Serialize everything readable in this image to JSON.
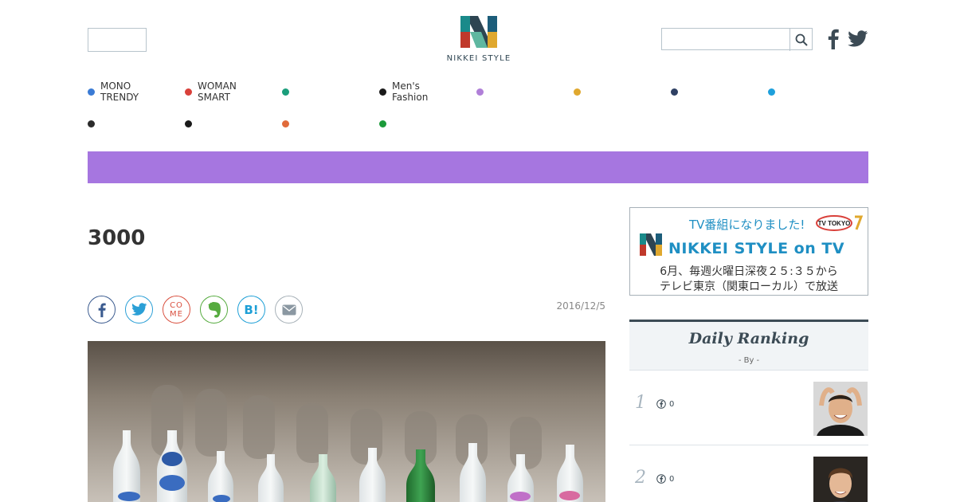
{
  "header": {
    "logo_text": "NIKKEI STYLE",
    "search": {
      "placeholder": "",
      "button_icon": "search-icon"
    },
    "social": [
      "facebook-icon",
      "twitter-icon"
    ]
  },
  "nav": {
    "row1": [
      {
        "label": "MONO\nTRENDY",
        "color": "#3a7bd5"
      },
      {
        "label": "WOMAN\nSMART",
        "color": "#d9403a"
      },
      {
        "label": "",
        "color": "#1a9e7b"
      },
      {
        "label": "Men's\nFashion",
        "color": "#1a1a1a"
      },
      {
        "label": "",
        "color": "#b07fd8"
      },
      {
        "label": "",
        "color": "#e0a82e"
      },
      {
        "label": "",
        "color": "#2e4063"
      },
      {
        "label": "",
        "color": "#1ea0dc"
      }
    ],
    "row2": [
      {
        "label": "",
        "color": "#2b2b2b"
      },
      {
        "label": "",
        "color": "#1a1a1a"
      },
      {
        "label": "",
        "color": "#e06a3a"
      },
      {
        "label": "",
        "color": "#1b9a3a"
      }
    ]
  },
  "banner": {
    "color": "#a676e0"
  },
  "article": {
    "title": "3000",
    "date": "2016/12/5",
    "share_buttons": [
      "facebook-icon",
      "twitter-icon",
      "come-icon",
      "evernote-icon",
      "hatena-bookmark-icon",
      "mail-icon"
    ],
    "share_come_text": "CO\nME",
    "share_hatena_text": "B!"
  },
  "sidebar": {
    "tv_ad": {
      "line1": "TV番組になりました!",
      "tv_logo": "TV TOKYO",
      "brand": "NIKKEI STYLE on TV",
      "line3": "6月、毎週火曜日深夜２５:３５から",
      "line4": "テレビ東京（関東ローカル）で放送"
    },
    "ranking": {
      "title": "Daily Ranking",
      "by": "- By  -",
      "items": [
        {
          "rank": "1",
          "count": "0"
        },
        {
          "rank": "2",
          "count": "0"
        }
      ]
    }
  }
}
